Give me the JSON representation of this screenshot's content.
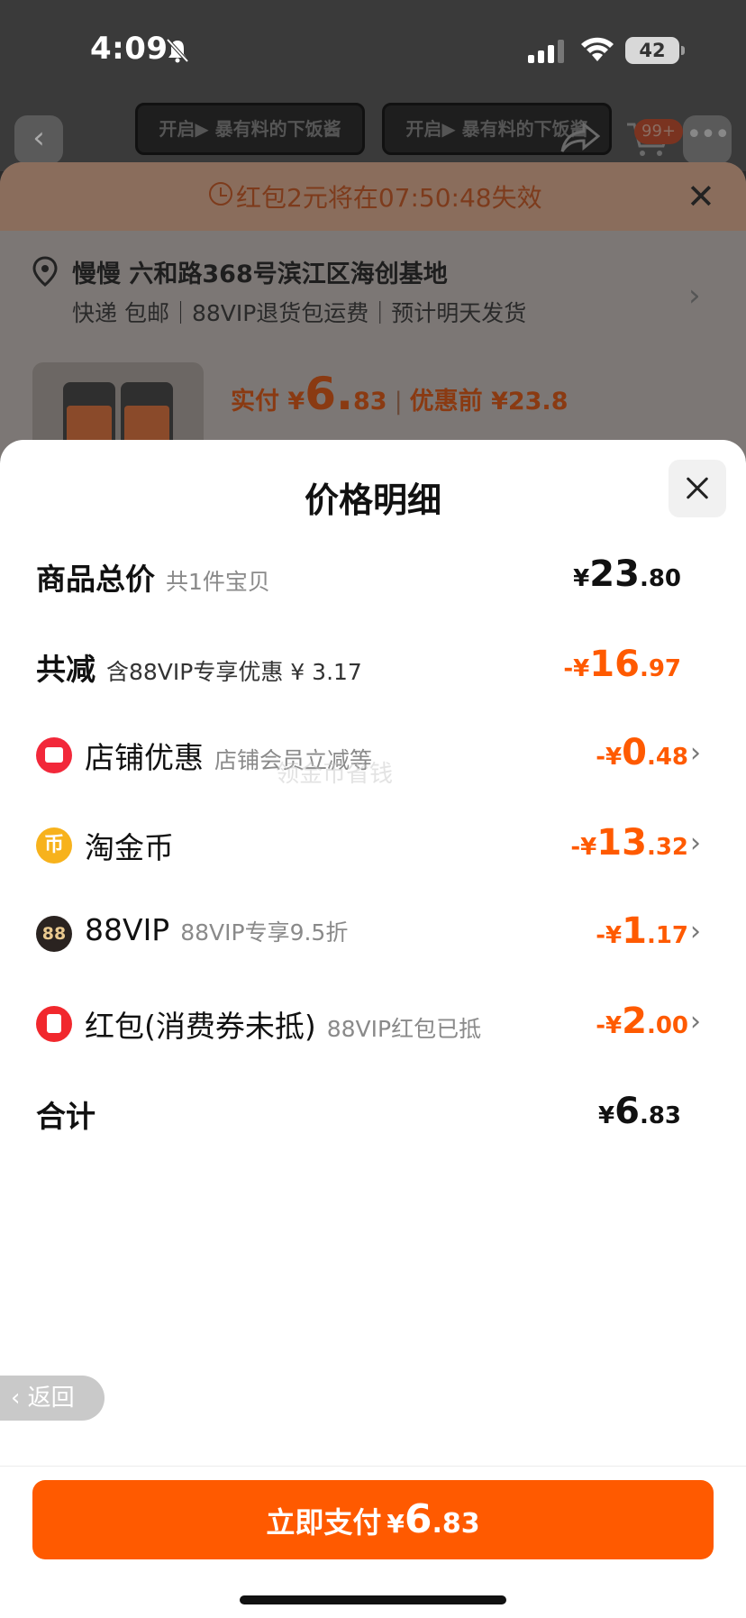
{
  "status_bar": {
    "time": "4:09",
    "battery": "42"
  },
  "background": {
    "banner_text": "开启▶ 暴有料的下饭酱",
    "cart_badge": "99+",
    "warning": "红包2元将在07:50:48失效",
    "address": {
      "name": "慢慢 六和路368号滨江区海创基地",
      "details": "快递 包邮｜88VIP退货包运费｜预计明天发货"
    },
    "price": {
      "actual_label": "实付 ¥",
      "actual_int": "6.",
      "actual_dec": "83",
      "separator": "|",
      "original": "优惠前 ¥23.8"
    }
  },
  "modal": {
    "title": "价格明细",
    "rows": [
      {
        "label": "商品总价",
        "sub": "共1件宝贝",
        "amount": {
          "cur": "¥",
          "int": "23",
          "dec": ".80"
        }
      },
      {
        "label": "共减",
        "sub": "含88VIP专享优惠 ¥ 3.17",
        "amount": {
          "cur": "-¥",
          "int": "16",
          "dec": ".97"
        }
      },
      {
        "label": "店铺优惠",
        "sub": "店铺会员立减等",
        "amount": {
          "cur": "-¥",
          "int": "0",
          "dec": ".48"
        }
      },
      {
        "label": "淘金币",
        "sub": "",
        "amount": {
          "cur": "-¥",
          "int": "13",
          "dec": ".32"
        }
      },
      {
        "label": "88VIP",
        "sub": "88VIP专享9.5折",
        "amount": {
          "cur": "-¥",
          "int": "1",
          "dec": ".17"
        }
      },
      {
        "label": "红包(消费券未抵)",
        "sub": "88VIP红包已抵",
        "amount": {
          "cur": "-¥",
          "int": "2",
          "dec": ".00"
        }
      },
      {
        "label": "合计",
        "sub": "",
        "amount": {
          "cur": "¥",
          "int": "6",
          "dec": ".83"
        }
      }
    ],
    "watermark": "领金币省钱"
  },
  "back_button": "返回",
  "pay_button": {
    "label": "立即支付",
    "cur": "¥",
    "int": "6",
    "dec": ".83"
  },
  "icons": {
    "shop": "shop-icon",
    "coin": "coin-icon",
    "vip": "vip-88-icon",
    "redpack": "red-packet-icon"
  },
  "colors": {
    "accent": "#ff5a00",
    "shop_icon": "#f2283a",
    "coin_icon": "#f7b21c",
    "vip_icon": "#2a2320"
  }
}
